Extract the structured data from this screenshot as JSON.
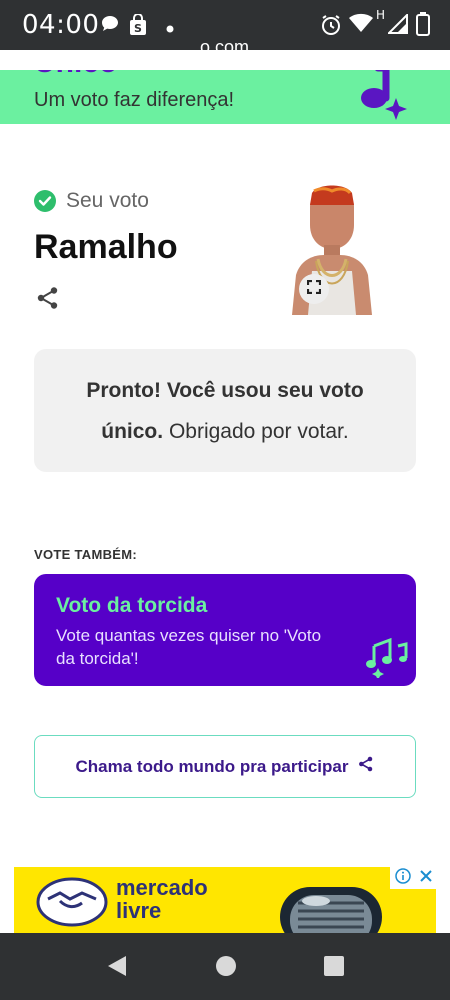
{
  "status_bar": {
    "time": "04:00",
    "url": "o.com",
    "icons": [
      "chat-icon",
      "store-icon",
      "dot-icon",
      "alarm-icon",
      "wifi-icon",
      "signal-icon",
      "battery-icon"
    ],
    "network_label": "H"
  },
  "banner": {
    "title": "Único",
    "subtitle": "Um voto faz diferença!",
    "icon": "music-note-icon",
    "color": "#6bf0a0"
  },
  "vote": {
    "status_label": "Seu voto",
    "candidate": "Ramalho",
    "photo_alt": "candidate-photo"
  },
  "confirmation": {
    "bold_text": "Pronto! Você usou seu voto",
    "bold_text_2": "único.",
    "regular_text": " Obrigado por votar."
  },
  "also_vote_label": "VOTE TAMBÉM:",
  "torcida": {
    "title": "Voto da torcida",
    "description": "Vote quantas vezes quiser no 'Voto da torcida'!",
    "color": "#5600c8"
  },
  "invite": {
    "label": "Chama todo mundo pra participar"
  },
  "ad": {
    "brand": "mercado\nlivre",
    "brand_line1": "mercado",
    "brand_line2": "livre"
  },
  "colors": {
    "accent_green": "#6bf0a0",
    "accent_purple": "#5600c8",
    "check_green": "#2ebe6c"
  }
}
